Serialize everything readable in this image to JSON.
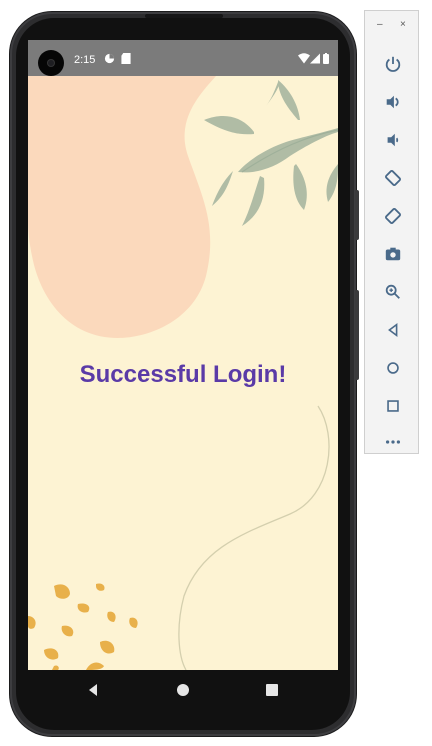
{
  "status_bar": {
    "time": "2:15",
    "left_icons": [
      "data-saver-icon",
      "sd-card-icon"
    ],
    "right_icons": [
      "wifi-icon",
      "signal-icon",
      "battery-icon"
    ]
  },
  "main": {
    "message": "Successful Login!"
  },
  "nav_bar": {
    "buttons": [
      "back-icon",
      "home-icon",
      "recents-icon"
    ]
  },
  "emulator_toolbar": {
    "minimize_label": "–",
    "close_label": "×",
    "buttons": [
      "power-icon",
      "volume-up-icon",
      "volume-down-icon",
      "rotate-left-icon",
      "rotate-right-icon",
      "camera-icon",
      "zoom-icon",
      "back-icon",
      "home-icon",
      "overview-icon",
      "more-icon"
    ]
  },
  "colors": {
    "screen_background": "#fdf3d3",
    "peach_shape": "#fbd9bc",
    "leaf": "#a8b7a1",
    "speckles": "#e8b04a",
    "message": "#5a3aa7",
    "status_bar": "#7b7b7b"
  }
}
